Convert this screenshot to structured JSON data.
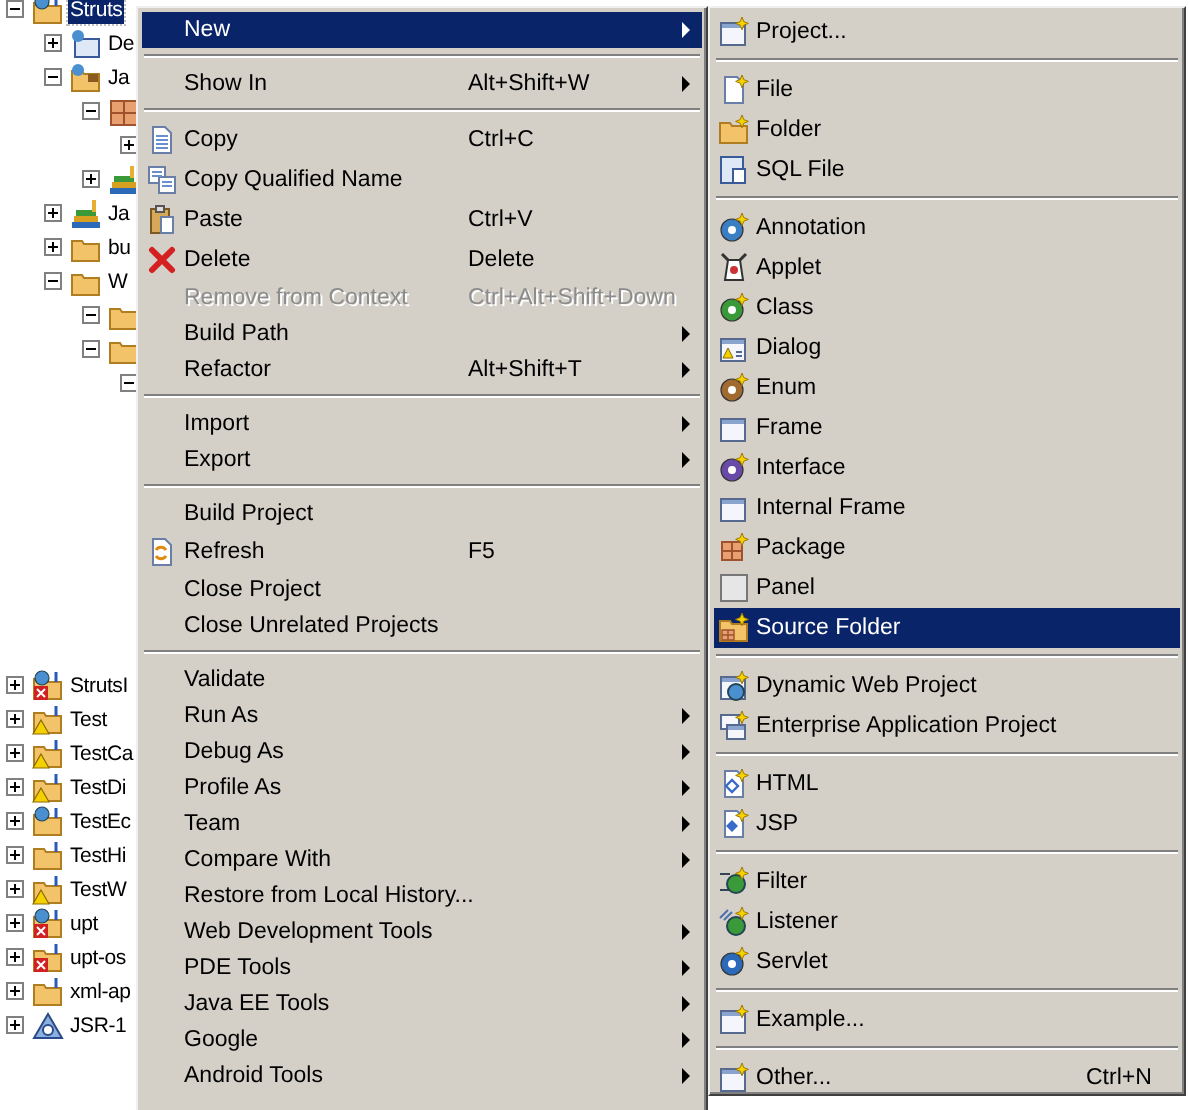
{
  "tree": {
    "items": [
      {
        "label": "Struts",
        "kind": "web-project",
        "error": false,
        "warning": false,
        "selected": true,
        "expanded": true,
        "children": [
          {
            "label": "De",
            "kind": "deployment",
            "selected": false,
            "expanded": false
          },
          {
            "label": "Ja",
            "kind": "java-resources",
            "selected": false,
            "expanded": true,
            "children": [
              {
                "kind": "package",
                "expanded": true,
                "children": [
                  {
                    "expanded": false
                  }
                ]
              },
              {
                "kind": "library",
                "expanded": false
              }
            ]
          },
          {
            "label": "Ja",
            "kind": "library",
            "selected": false,
            "expanded": false
          },
          {
            "label": "bu",
            "kind": "folder",
            "selected": false,
            "expanded": false
          },
          {
            "label": "W",
            "kind": "folder",
            "selected": false,
            "expanded": true,
            "children": [
              {
                "kind": "folder",
                "expanded": true
              },
              {
                "kind": "folder",
                "expanded": true,
                "children": [
                  {
                    "expanded": true
                  }
                ]
              }
            ]
          }
        ]
      },
      {
        "label": "StrutsI",
        "kind": "web-project",
        "error": true,
        "warning": false,
        "selected": false,
        "expanded": false
      },
      {
        "label": "Test",
        "kind": "project",
        "error": false,
        "warning": true,
        "selected": false,
        "expanded": false
      },
      {
        "label": "TestCa",
        "kind": "project",
        "error": false,
        "warning": true,
        "selected": false,
        "expanded": false
      },
      {
        "label": "TestDi",
        "kind": "project",
        "error": false,
        "warning": true,
        "selected": false,
        "expanded": false
      },
      {
        "label": "TestEc",
        "kind": "web-project",
        "error": false,
        "warning": false,
        "selected": false,
        "expanded": false
      },
      {
        "label": "TestHi",
        "kind": "project",
        "error": false,
        "warning": false,
        "selected": false,
        "expanded": false
      },
      {
        "label": "TestW",
        "kind": "project",
        "error": false,
        "warning": true,
        "selected": false,
        "expanded": false
      },
      {
        "label": "upt",
        "kind": "web-project",
        "error": true,
        "warning": false,
        "selected": false,
        "expanded": false
      },
      {
        "label": "upt-os",
        "kind": "project",
        "error": true,
        "warning": false,
        "selected": false,
        "expanded": false
      },
      {
        "label": "xml-ap",
        "kind": "project",
        "error": false,
        "warning": false,
        "selected": false,
        "expanded": false
      },
      {
        "label": "JSR-1",
        "kind": "jsr",
        "error": false,
        "warning": false,
        "selected": false,
        "expanded": false
      }
    ]
  },
  "context_menu": {
    "groups": [
      {
        "items": [
          {
            "label": "New",
            "submenu": true,
            "selected": true,
            "disabled": false
          }
        ]
      },
      {
        "items": [
          {
            "label": "Show In",
            "shortcut": "Alt+Shift+W",
            "submenu": true,
            "selected": false,
            "disabled": false
          }
        ]
      },
      {
        "items": [
          {
            "label": "Copy",
            "shortcut": "Ctrl+C",
            "submenu": false,
            "selected": false,
            "disabled": false
          },
          {
            "label": "Copy Qualified Name",
            "submenu": false,
            "selected": false,
            "disabled": false
          },
          {
            "label": "Paste",
            "shortcut": "Ctrl+V",
            "submenu": false,
            "selected": false,
            "disabled": false
          },
          {
            "label": "Delete",
            "shortcut": "Delete",
            "submenu": false,
            "selected": false,
            "disabled": false
          },
          {
            "label": "Remove from Context",
            "shortcut": "Ctrl+Alt+Shift+Down",
            "submenu": false,
            "selected": false,
            "disabled": true
          },
          {
            "label": "Build Path",
            "submenu": true,
            "selected": false,
            "disabled": false
          },
          {
            "label": "Refactor",
            "shortcut": "Alt+Shift+T",
            "submenu": true,
            "selected": false,
            "disabled": false
          }
        ]
      },
      {
        "items": [
          {
            "label": "Import",
            "submenu": true,
            "selected": false,
            "disabled": false
          },
          {
            "label": "Export",
            "submenu": true,
            "selected": false,
            "disabled": false
          }
        ]
      },
      {
        "items": [
          {
            "label": "Build Project",
            "submenu": false,
            "selected": false,
            "disabled": false
          },
          {
            "label": "Refresh",
            "shortcut": "F5",
            "submenu": false,
            "selected": false,
            "disabled": false
          },
          {
            "label": "Close Project",
            "submenu": false,
            "selected": false,
            "disabled": false
          },
          {
            "label": "Close Unrelated Projects",
            "submenu": false,
            "selected": false,
            "disabled": false
          }
        ]
      },
      {
        "items": [
          {
            "label": "Validate",
            "submenu": false,
            "selected": false,
            "disabled": false
          },
          {
            "label": "Run As",
            "submenu": true,
            "selected": false,
            "disabled": false
          },
          {
            "label": "Debug As",
            "submenu": true,
            "selected": false,
            "disabled": false
          },
          {
            "label": "Profile As",
            "submenu": true,
            "selected": false,
            "disabled": false
          },
          {
            "label": "Team",
            "submenu": true,
            "selected": false,
            "disabled": false
          },
          {
            "label": "Compare With",
            "submenu": true,
            "selected": false,
            "disabled": false
          },
          {
            "label": "Restore from Local History...",
            "submenu": false,
            "selected": false,
            "disabled": false
          },
          {
            "label": "Web Development Tools",
            "submenu": true,
            "selected": false,
            "disabled": false
          },
          {
            "label": "PDE Tools",
            "submenu": true,
            "selected": false,
            "disabled": false
          },
          {
            "label": "Java EE Tools",
            "submenu": true,
            "selected": false,
            "disabled": false
          },
          {
            "label": "Google",
            "submenu": true,
            "selected": false,
            "disabled": false
          },
          {
            "label": "Android Tools",
            "submenu": true,
            "selected": false,
            "disabled": false
          }
        ]
      }
    ]
  },
  "new_submenu": {
    "groups": [
      {
        "items": [
          {
            "label": "Project...",
            "selected": false
          }
        ]
      },
      {
        "items": [
          {
            "label": "File",
            "selected": false
          },
          {
            "label": "Folder",
            "selected": false
          },
          {
            "label": "SQL File",
            "selected": false
          }
        ]
      },
      {
        "items": [
          {
            "label": "Annotation",
            "selected": false
          },
          {
            "label": "Applet",
            "selected": false
          },
          {
            "label": "Class",
            "selected": false
          },
          {
            "label": "Dialog",
            "selected": false
          },
          {
            "label": "Enum",
            "selected": false
          },
          {
            "label": "Frame",
            "selected": false
          },
          {
            "label": "Interface",
            "selected": false
          },
          {
            "label": "Internal Frame",
            "selected": false
          },
          {
            "label": "Package",
            "selected": false
          },
          {
            "label": "Panel",
            "selected": false
          },
          {
            "label": "Source Folder",
            "selected": true
          }
        ]
      },
      {
        "items": [
          {
            "label": "Dynamic Web Project",
            "selected": false
          },
          {
            "label": "Enterprise Application Project",
            "selected": false
          }
        ]
      },
      {
        "items": [
          {
            "label": "HTML",
            "selected": false
          },
          {
            "label": "JSP",
            "selected": false
          }
        ]
      },
      {
        "items": [
          {
            "label": "Filter",
            "selected": false
          },
          {
            "label": "Listener",
            "selected": false
          },
          {
            "label": "Servlet",
            "selected": false
          }
        ]
      },
      {
        "items": [
          {
            "label": "Example...",
            "selected": false
          }
        ]
      },
      {
        "items": [
          {
            "label": "Other...",
            "shortcut": "Ctrl+N",
            "selected": false
          }
        ]
      }
    ]
  }
}
